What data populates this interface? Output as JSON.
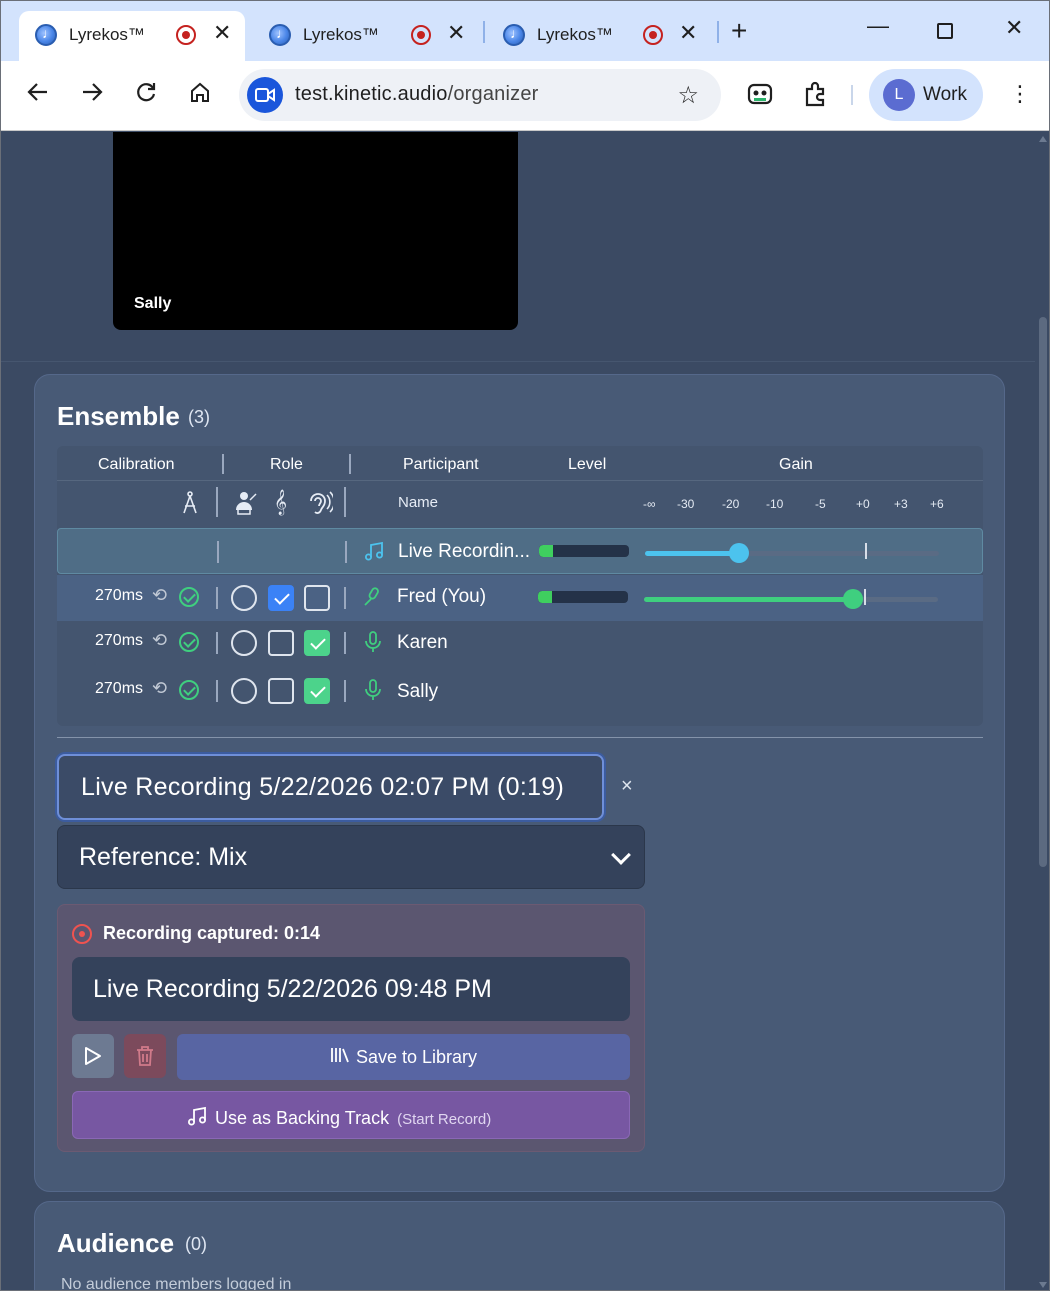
{
  "browser": {
    "tabs": [
      {
        "title": "Lyrekos™",
        "active": true
      },
      {
        "title": "Lyrekos™",
        "active": false
      },
      {
        "title": "Lyrekos™",
        "active": false
      }
    ],
    "url_host": "test.kinetic.audio",
    "url_path": "/organizer",
    "profile_initial": "L",
    "profile_name": "Work"
  },
  "video": {
    "tile_label": "Sally"
  },
  "ensemble": {
    "title": "Ensemble",
    "count": "(3)",
    "headers": {
      "calibration": "Calibration",
      "role": "Role",
      "participant": "Participant",
      "level": "Level",
      "gain": "Gain",
      "name": "Name"
    },
    "gain_ticks": [
      "-∞",
      "-30",
      "-20",
      "-10",
      "-5",
      "+0",
      "+3",
      "+6"
    ],
    "rows": [
      {
        "kind": "live",
        "name": "Live Recordin...",
        "level": 0.15,
        "gain": 0.32
      },
      {
        "kind": "you",
        "latency": "270ms",
        "name": "Fred (You)",
        "level": 0.15,
        "gain": 0.71,
        "role_checked": "blue"
      },
      {
        "kind": "member",
        "latency": "270ms",
        "name": "Karen",
        "role_checked": "green"
      },
      {
        "kind": "member",
        "latency": "270ms",
        "name": "Sally",
        "role_checked": "green"
      }
    ],
    "recording_title": "Live Recording 5/22/2026 02:07 PM (0:19)",
    "clear_label": "×",
    "reference_select": "Reference: Mix",
    "captured": {
      "label": "Recording captured: 0:14",
      "name": "Live Recording 5/22/2026 09:48 PM",
      "save_label": "Save to Library",
      "backing_label": "Use as Backing Track",
      "backing_sub": "(Start Record)"
    }
  },
  "audience": {
    "title": "Audience",
    "count": "(0)",
    "empty_text": "No audience members logged in"
  },
  "colors": {
    "accent_blue": "#3b82f6",
    "accent_green": "#4cd38b",
    "gain_live": "#4cc3ee",
    "gain_you": "#3fcf7f",
    "rec_red": "#ef5350"
  }
}
